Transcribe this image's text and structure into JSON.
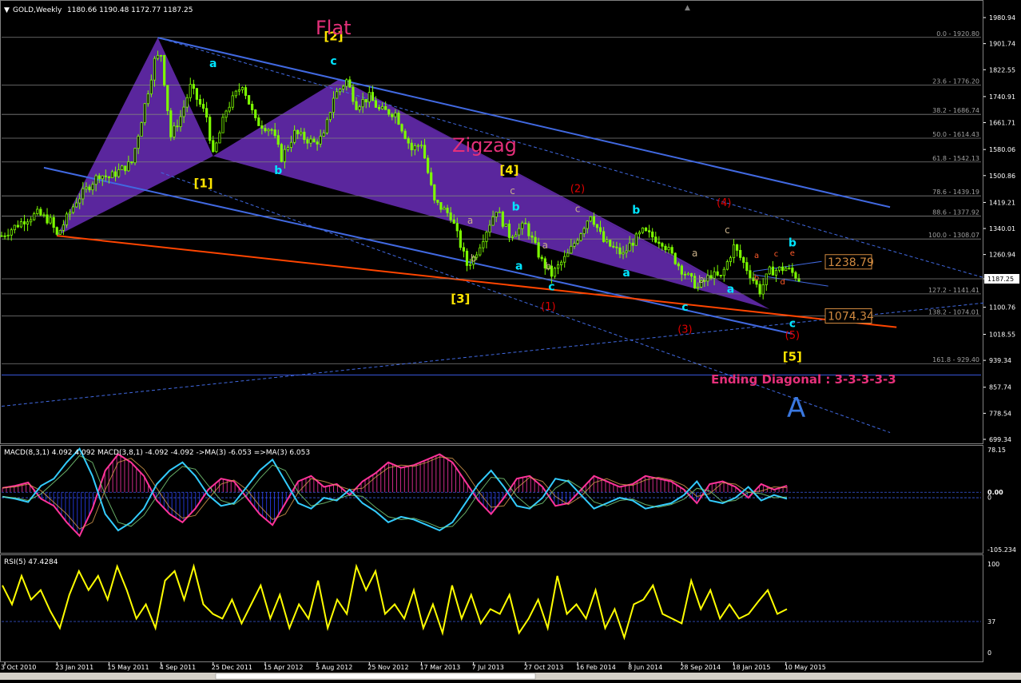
{
  "header": {
    "symbol": "GOLD,Weekly",
    "ohlc": "1180.66 1190.48 1172.77 1187.25"
  },
  "colors": {
    "background": "#000000",
    "bull": "#7CFC00",
    "bear": "#7CFC00",
    "channel": "#4169E1",
    "trendline": "#FF4500",
    "triangle": "#6A2DB8",
    "wave_cyan": "#00E5FF",
    "wave_yellow": "#FFE600",
    "wave_red": "#E00000",
    "wave_tan": "#C8B08A",
    "pink": "#E5307A",
    "macd_pink": "#FF3399",
    "macd_cyan": "#33CCFF",
    "rsi": "#FFFF00",
    "axis_text": "#FFFFFF",
    "grid": "#808080"
  },
  "chart_data": [
    {
      "type": "candlestick",
      "title": "GOLD,Weekly",
      "ylim": [
        699.34,
        1980.94
      ],
      "price_axis_labels": [
        "1980.94",
        "1901.74",
        "1822.55",
        "1740.91",
        "1661.71",
        "1580.06",
        "1500.86",
        "1419.21",
        "1340.01",
        "1260.94",
        "1187.25",
        "1100.76",
        "1018.55",
        "939.34",
        "857.74",
        "778.54",
        "699.34"
      ],
      "x_axis_labels": [
        "3 Oct 2010",
        "23 Jan 2011",
        "15 May 2011",
        "4 Sep 2011",
        "25 Dec 2011",
        "15 Apr 2012",
        "5 Aug 2012",
        "25 Nov 2012",
        "17 Mar 2013",
        "7 Jul 2013",
        "27 Oct 2013",
        "16 Feb 2014",
        "8 Jun 2014",
        "28 Sep 2014",
        "18 Jan 2015",
        "10 May 2015"
      ],
      "x_start": "2010-09-26",
      "x_end": "2015-06-07",
      "close_path": [
        [
          "2010-09-26",
          1318
        ],
        [
          "2010-11-14",
          1366
        ],
        [
          "2010-12-12",
          1385
        ],
        [
          "2011-01-09",
          1363
        ],
        [
          "2011-01-23",
          1318
        ],
        [
          "2011-03-06",
          1425
        ],
        [
          "2011-04-24",
          1505
        ],
        [
          "2011-05-15",
          1495
        ],
        [
          "2011-07-03",
          1540
        ],
        [
          "2011-08-07",
          1760
        ],
        [
          "2011-08-21",
          1850
        ],
        [
          "2011-09-04",
          1870
        ],
        [
          "2011-09-25",
          1620
        ],
        [
          "2011-10-16",
          1680
        ],
        [
          "2011-11-06",
          1770
        ],
        [
          "2011-12-11",
          1680
        ],
        [
          "2011-12-25",
          1560
        ],
        [
          "2012-01-22",
          1700
        ],
        [
          "2012-02-26",
          1780
        ],
        [
          "2012-03-25",
          1665
        ],
        [
          "2012-04-29",
          1640
        ],
        [
          "2012-05-20",
          1555
        ],
        [
          "2012-06-17",
          1630
        ],
        [
          "2012-07-29",
          1600
        ],
        [
          "2012-08-19",
          1620
        ],
        [
          "2012-09-09",
          1740
        ],
        [
          "2012-10-07",
          1790
        ],
        [
          "2012-10-28",
          1715
        ],
        [
          "2012-11-25",
          1740
        ],
        [
          "2012-12-16",
          1700
        ],
        [
          "2013-01-20",
          1690
        ],
        [
          "2013-02-24",
          1580
        ],
        [
          "2013-03-17",
          1600
        ],
        [
          "2013-04-14",
          1420
        ],
        [
          "2013-05-19",
          1380
        ],
        [
          "2013-06-23",
          1230
        ],
        [
          "2013-07-07",
          1250
        ],
        [
          "2013-08-25",
          1400
        ],
        [
          "2013-09-22",
          1320
        ],
        [
          "2013-10-27",
          1350
        ],
        [
          "2013-12-01",
          1240
        ],
        [
          "2013-12-22",
          1200
        ],
        [
          "2014-01-26",
          1260
        ],
        [
          "2014-03-16",
          1385
        ],
        [
          "2014-04-13",
          1300
        ],
        [
          "2014-05-25",
          1260
        ],
        [
          "2014-06-08",
          1290
        ],
        [
          "2014-07-06",
          1330
        ],
        [
          "2014-08-17",
          1300
        ],
        [
          "2014-09-28",
          1215
        ],
        [
          "2014-11-02",
          1160
        ],
        [
          "2014-11-30",
          1200
        ],
        [
          "2014-12-21",
          1190
        ],
        [
          "2015-01-18",
          1285
        ],
        [
          "2015-02-08",
          1235
        ],
        [
          "2015-03-15",
          1150
        ],
        [
          "2015-04-05",
          1210
        ],
        [
          "2015-05-10",
          1220
        ],
        [
          "2015-05-24",
          1205
        ],
        [
          "2015-06-07",
          1187
        ]
      ],
      "fibonacci": [
        {
          "label": "0.0 - 1920.80",
          "price": 1920.8
        },
        {
          "label": "23.6 - 1776.20",
          "price": 1776.2
        },
        {
          "label": "38.2 - 1686.74",
          "price": 1686.74
        },
        {
          "label": "50.0 - 1614.43",
          "price": 1614.43
        },
        {
          "label": "61.8 - 1542.13",
          "price": 1542.13
        },
        {
          "label": "78.6 - 1439.19",
          "price": 1439.19
        },
        {
          "label": "88.6 - 1377.92",
          "price": 1377.92
        },
        {
          "label": "100.0 - 1308.07",
          "price": 1308.07
        },
        {
          "label": "127.2 - 1141.41",
          "price": 1141.41
        },
        {
          "label": "138.2 - 1074.01",
          "price": 1074.01
        },
        {
          "label": "161.8 - 929.40",
          "price": 929.4
        }
      ],
      "price_boxes": [
        {
          "label": "1238.79",
          "price": 1238.79
        },
        {
          "label": "1074.34",
          "price": 1074.34
        }
      ],
      "current_price": "1187.25",
      "annotations": {
        "flat": "Flat",
        "zigzag": "Zigzag",
        "ending_diagonal": "Ending Diagonal : 3-3-3-3-3",
        "big_A": "A"
      },
      "wave_labels": {
        "yellow": [
          {
            "text": "[1]",
            "date": "2011-12-04",
            "price": 1465
          },
          {
            "text": "[2]",
            "date": "2012-09-09",
            "price": 1912
          },
          {
            "text": "[3]",
            "date": "2013-06-09",
            "price": 1115
          },
          {
            "text": "[4]",
            "date": "2013-09-22",
            "price": 1505
          },
          {
            "text": "[5]",
            "date": "2015-05-24",
            "price": 938
          }
        ],
        "cyan": [
          {
            "text": "a",
            "date": "2011-12-25",
            "price": 1830
          },
          {
            "text": "b",
            "date": "2012-05-13",
            "price": 1505
          },
          {
            "text": "c",
            "date": "2012-09-09",
            "price": 1838
          },
          {
            "text": "c",
            "date": "2013-12-22",
            "price": 1152
          },
          {
            "text": "a",
            "date": "2013-10-13",
            "price": 1215
          },
          {
            "text": "b",
            "date": "2013-10-06",
            "price": 1395
          },
          {
            "text": "a",
            "date": "2014-06-01",
            "price": 1195
          },
          {
            "text": "b",
            "date": "2014-06-22",
            "price": 1385
          },
          {
            "text": "c",
            "date": "2014-10-05",
            "price": 1090
          },
          {
            "text": "a",
            "date": "2015-01-11",
            "price": 1145
          },
          {
            "text": "b",
            "date": "2015-05-24",
            "price": 1285
          },
          {
            "text": "c",
            "date": "2015-05-24",
            "price": 1040
          }
        ],
        "red": [
          {
            "text": "(1)",
            "date": "2013-12-15",
            "price": 1092
          },
          {
            "text": "(2)",
            "date": "2014-02-16",
            "price": 1450
          },
          {
            "text": "(3)",
            "date": "2014-10-05",
            "price": 1023
          },
          {
            "text": "(4)",
            "date": "2014-12-28",
            "price": 1408
          },
          {
            "text": "(5)",
            "date": "2015-05-24",
            "price": 1005
          }
        ],
        "tan": [
          {
            "text": "c",
            "date": "2013-09-29",
            "price": 1445
          },
          {
            "text": "a",
            "date": "2013-06-30",
            "price": 1355
          },
          {
            "text": "b",
            "date": "2013-07-07",
            "price": 1240
          },
          {
            "text": "a",
            "date": "2013-12-08",
            "price": 1280
          },
          {
            "text": "b",
            "date": "2013-12-15",
            "price": 1215
          },
          {
            "text": "c",
            "date": "2014-02-16",
            "price": 1390
          },
          {
            "text": "a",
            "date": "2014-10-26",
            "price": 1255
          },
          {
            "text": "b",
            "date": "2014-11-09",
            "price": 1175
          },
          {
            "text": "c",
            "date": "2015-01-04",
            "price": 1325
          }
        ],
        "orange": [
          {
            "text": "a",
            "date": "2015-03-08",
            "price": 1250
          },
          {
            "text": "b",
            "date": "2015-03-08",
            "price": 1182
          },
          {
            "text": "c",
            "date": "2015-04-19",
            "price": 1255
          },
          {
            "text": "d",
            "date": "2015-05-03",
            "price": 1170
          },
          {
            "text": "e",
            "date": "2015-05-24",
            "price": 1258
          }
        ]
      }
    },
    {
      "type": "line",
      "title": "MACD(8,3,1) 4.092 4.092  MACD(3,8,1) -4.092 -4.092  ->MA(3) -6.053  =>MA(3) 6.053",
      "ylim": [
        -105.234,
        78.15
      ],
      "axis_labels": [
        "78.15",
        "0.00",
        "0",
        "-105.234"
      ],
      "series": [
        {
          "name": "MACD(8,3,1)",
          "color": "#FF3399",
          "values": [
            8,
            12,
            18,
            -12,
            -25,
            -55,
            -80,
            -30,
            40,
            70,
            55,
            30,
            -15,
            -40,
            -55,
            -30,
            5,
            25,
            20,
            -10,
            -40,
            -60,
            -20,
            20,
            30,
            10,
            15,
            -5,
            20,
            35,
            55,
            45,
            50,
            60,
            70,
            55,
            20,
            -15,
            -40,
            -10,
            25,
            30,
            10,
            -25,
            -20,
            5,
            30,
            20,
            10,
            15,
            30,
            25,
            20,
            5,
            -20,
            15,
            20,
            10,
            -10,
            15,
            5,
            12
          ]
        },
        {
          "name": "MACD(3,8,1)",
          "color": "#33CCFF",
          "values": [
            -8,
            -12,
            -18,
            12,
            25,
            55,
            80,
            30,
            -40,
            -70,
            -55,
            -30,
            15,
            40,
            55,
            30,
            -5,
            -25,
            -20,
            10,
            40,
            60,
            20,
            -20,
            -30,
            -10,
            -15,
            5,
            -20,
            -35,
            -55,
            -45,
            -50,
            -60,
            -70,
            -55,
            -20,
            15,
            40,
            10,
            -25,
            -30,
            -10,
            25,
            20,
            -5,
            -30,
            -20,
            -10,
            -15,
            -30,
            -25,
            -20,
            -5,
            20,
            -15,
            -20,
            -10,
            10,
            -15,
            -5,
            -12
          ]
        }
      ]
    },
    {
      "type": "line",
      "title": "RSI(5) 47.4284",
      "ylim": [
        0,
        100
      ],
      "axis_labels": [
        "100",
        "37",
        "0"
      ],
      "level": 37,
      "series": [
        {
          "name": "RSI(5)",
          "color": "#FFFF00",
          "values": [
            75,
            55,
            85,
            60,
            70,
            48,
            30,
            65,
            90,
            70,
            85,
            60,
            95,
            70,
            40,
            55,
            30,
            80,
            90,
            60,
            95,
            55,
            45,
            40,
            60,
            35,
            55,
            75,
            40,
            65,
            30,
            55,
            40,
            80,
            30,
            60,
            45,
            95,
            70,
            90,
            45,
            55,
            40,
            70,
            30,
            55,
            25,
            75,
            40,
            65,
            35,
            50,
            45,
            65,
            25,
            40,
            60,
            30,
            85,
            45,
            55,
            40,
            70,
            30,
            50,
            20,
            55,
            60,
            75,
            45,
            40,
            35,
            80,
            50,
            70,
            40,
            55,
            40,
            45,
            58,
            70,
            45,
            50
          ]
        }
      ]
    }
  ]
}
